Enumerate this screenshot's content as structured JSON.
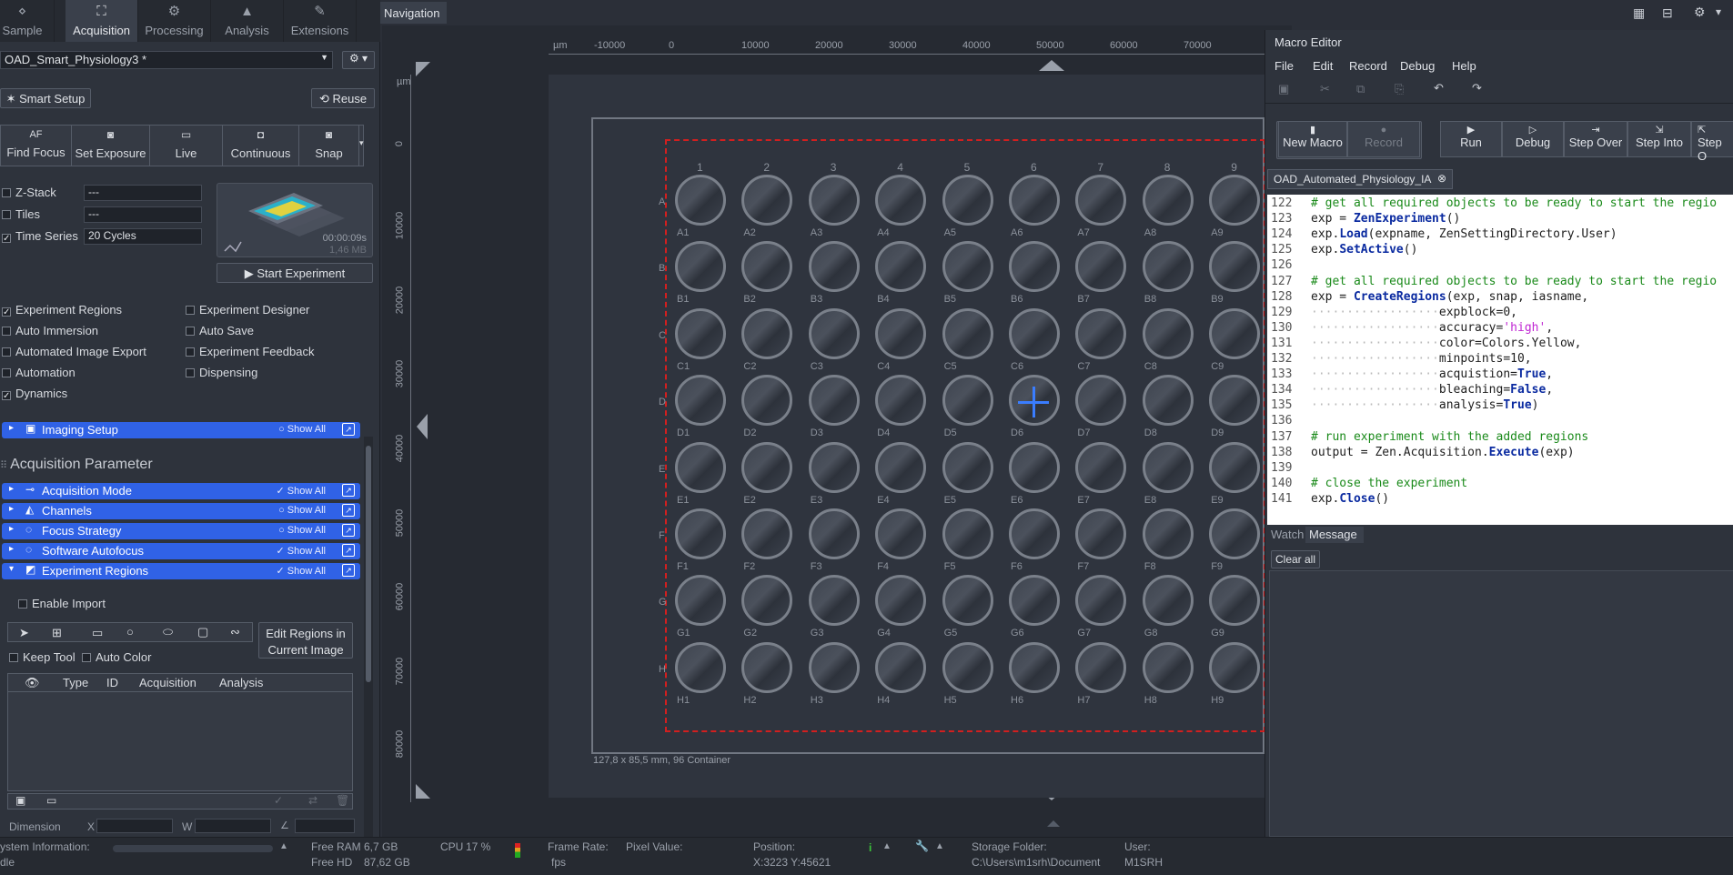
{
  "left_tabs": [
    {
      "label": "Sample",
      "icon": "sample-icon"
    },
    {
      "label": "Acquisition",
      "icon": "acquisition-icon"
    },
    {
      "label": "Processing",
      "icon": "processing-icon"
    },
    {
      "label": "Analysis",
      "icon": "analysis-icon"
    },
    {
      "label": "Extensions",
      "icon": "extensions-icon"
    }
  ],
  "experiment_name": "OAD_Smart_Physiology3 *",
  "smart_setup": "Smart Setup",
  "reuse": "Reuse",
  "acq_buttons": [
    "Find Focus",
    "Set Exposure",
    "Live",
    "Continuous",
    "Snap"
  ],
  "af_label": "AF",
  "dimensions": [
    {
      "label": "Z-Stack",
      "checked": false,
      "value": "---"
    },
    {
      "label": "Tiles",
      "checked": false,
      "value": "---"
    },
    {
      "label": "Time Series",
      "checked": true,
      "value": "20 Cycles"
    }
  ],
  "preview": {
    "time": "00:00:09s",
    "size": "1,46 MB"
  },
  "start_experiment": "Start Experiment",
  "options_left": [
    {
      "label": "Experiment Regions",
      "checked": true
    },
    {
      "label": "Auto Immersion",
      "checked": false
    },
    {
      "label": "Automated Image Export",
      "checked": false
    },
    {
      "label": "Automation",
      "checked": false
    },
    {
      "label": "Dynamics",
      "checked": true
    }
  ],
  "options_right": [
    {
      "label": "Experiment Designer",
      "checked": false
    },
    {
      "label": "Auto Save",
      "checked": false
    },
    {
      "label": "Experiment Feedback",
      "checked": false
    },
    {
      "label": "Dispensing",
      "checked": false
    }
  ],
  "imaging_setup": {
    "label": "Imaging Setup",
    "show_all": "Show All"
  },
  "acq_param_title": "Acquisition Parameter",
  "param_bars": [
    {
      "label": "Acquisition Mode",
      "show_all": "Show All",
      "checked": true
    },
    {
      "label": "Channels",
      "show_all": "Show All",
      "checked": false
    },
    {
      "label": "Focus Strategy",
      "show_all": "Show All",
      "checked": false
    },
    {
      "label": "Software Autofocus",
      "show_all": "Show All",
      "checked": true
    },
    {
      "label": "Experiment Regions",
      "show_all": "Show All",
      "checked": true
    }
  ],
  "enable_import": "Enable Import",
  "edit_regions": "Edit Regions in Current Image",
  "keep_tool": "Keep Tool",
  "auto_color": "Auto Color",
  "region_columns": [
    "Type",
    "ID",
    "Acquisition",
    "Analysis"
  ],
  "dimension_row": {
    "label": "Dimension",
    "x": "X",
    "w": "W"
  },
  "navigation_title": "Navigation",
  "ruler_x": [
    "µm",
    "-10000",
    "0",
    "10000",
    "20000",
    "30000",
    "40000",
    "50000",
    "60000",
    "70000"
  ],
  "ruler_y": [
    "µm",
    "0",
    "10000",
    "20000",
    "30000",
    "40000",
    "50000",
    "60000",
    "70000",
    "80000"
  ],
  "plate_label": "127,8 x 85,5 mm, 96 Container",
  "plate_rows": [
    "A",
    "B",
    "C",
    "D",
    "E",
    "F",
    "G",
    "H"
  ],
  "plate_cols": [
    "1",
    "2",
    "3",
    "4",
    "5",
    "6",
    "7",
    "8",
    "9"
  ],
  "macro": {
    "title": "Macro Editor",
    "menu": [
      "File",
      "Edit",
      "Record",
      "Debug",
      "Help"
    ],
    "buttons": [
      "New Macro",
      "Record",
      "Run",
      "Debug",
      "Step Over",
      "Step Into",
      "Step O"
    ],
    "file_tab": "OAD_Automated_Physiology_IA",
    "lines": [
      {
        "n": "122",
        "t": "# get all required objects to be ready to start the regio"
      },
      {
        "n": "123",
        "t": "exp = ZenExperiment()"
      },
      {
        "n": "124",
        "t": "exp.Load(expname, ZenSettingDirectory.User)"
      },
      {
        "n": "125",
        "t": "exp.SetActive()"
      },
      {
        "n": "126",
        "t": ""
      },
      {
        "n": "127",
        "t": "# get all required objects to be ready to start the regio"
      },
      {
        "n": "128",
        "t": "exp = CreateRegions(exp, snap, iasname,"
      },
      {
        "n": "129",
        "t": "expblock=0,"
      },
      {
        "n": "130",
        "t": "accuracy='high',"
      },
      {
        "n": "131",
        "t": "color=Colors.Yellow,"
      },
      {
        "n": "132",
        "t": "minpoints=10,"
      },
      {
        "n": "133",
        "t": "acquistion=True,"
      },
      {
        "n": "134",
        "t": "bleaching=False,"
      },
      {
        "n": "135",
        "t": "analysis=True)"
      },
      {
        "n": "136",
        "t": ""
      },
      {
        "n": "137",
        "t": "# run experiment with the added regions"
      },
      {
        "n": "138",
        "t": "output = Zen.Acquisition.Execute(exp)"
      },
      {
        "n": "139",
        "t": ""
      },
      {
        "n": "140",
        "t": "# close the experiment"
      },
      {
        "n": "141",
        "t": "exp.Close()"
      }
    ],
    "bottom_tabs": [
      "Watch",
      "Message"
    ],
    "clear_all": "Clear all"
  },
  "status": {
    "system_info": "ystem Information:",
    "idle": "dle",
    "free_ram_label": "Free RAM",
    "free_ram": "6,7 GB",
    "free_hd_label": "Free HD",
    "free_hd": "87,62 GB",
    "cpu_label": "CPU",
    "cpu": "17 %",
    "frame_rate_label": "Frame Rate:",
    "frame_rate_unit": "fps",
    "pixel_value_label": "Pixel Value:",
    "position_label": "Position:",
    "position": "X:3223  Y:45621",
    "storage_label": "Storage Folder:",
    "storage": "C:\\Users\\m1srh\\Document",
    "user_label": "User:",
    "user": "M1SRH"
  },
  "colors": {
    "accent_bar": "#3062e6",
    "region_border": "#d21f1f",
    "comment": "#1a8a1a"
  }
}
